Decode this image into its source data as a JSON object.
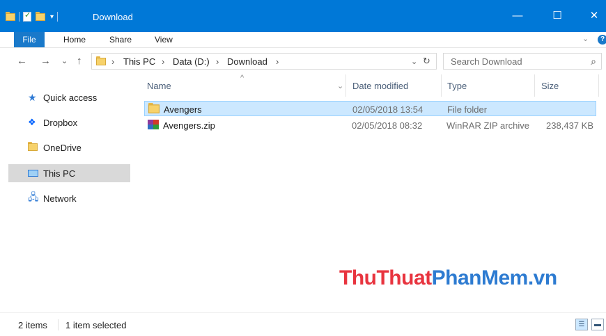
{
  "window": {
    "title": "Download",
    "minimize_glyph": "—",
    "maximize_glyph": "☐",
    "close_glyph": "✕"
  },
  "ribbon": {
    "tabs": [
      {
        "label": "File"
      },
      {
        "label": "Home"
      },
      {
        "label": "Share"
      },
      {
        "label": "View"
      }
    ],
    "expand_glyph": "⌄",
    "help_glyph": "?"
  },
  "address": {
    "back_glyph": "←",
    "forward_glyph": "→",
    "recent_glyph": "⌄",
    "up_glyph": "↑",
    "crumbs": [
      "This PC",
      "Data (D:)",
      "Download"
    ],
    "separator": "›",
    "dropdown_glyph": "⌄",
    "refresh_glyph": "↻"
  },
  "search": {
    "placeholder": "Search Download",
    "icon_glyph": "⌕"
  },
  "nav": {
    "items": [
      {
        "label": "Quick access",
        "icon": "star-icon"
      },
      {
        "label": "Dropbox",
        "icon": "dropbox-icon"
      },
      {
        "label": "OneDrive",
        "icon": "folder-icon"
      },
      {
        "label": "This PC",
        "icon": "monitor-icon"
      },
      {
        "label": "Network",
        "icon": "network-icon"
      }
    ]
  },
  "columns": {
    "name": "Name",
    "date": "Date modified",
    "type": "Type",
    "size": "Size",
    "sort_glyph": "^",
    "dropdown_glyph": "⌄"
  },
  "files": [
    {
      "name": "Avengers",
      "date": "02/05/2018 13:54",
      "type": "File folder",
      "size": "",
      "icon": "folder-icon"
    },
    {
      "name": "Avengers.zip",
      "date": "02/05/2018 08:32",
      "type": "WinRAR ZIP archive",
      "size": "238,437 KB",
      "icon": "winrar-icon"
    }
  ],
  "watermark": {
    "part1": "ThuThuat",
    "part2": "PhanMem",
    "part3": ".vn"
  },
  "status": {
    "count": "2 items",
    "selected": "1 item selected"
  },
  "colors": {
    "titlebar": "#0078d7",
    "selection": "#cce8ff",
    "watermark_red": "#e8343f",
    "watermark_blue": "#2d7bd1"
  }
}
